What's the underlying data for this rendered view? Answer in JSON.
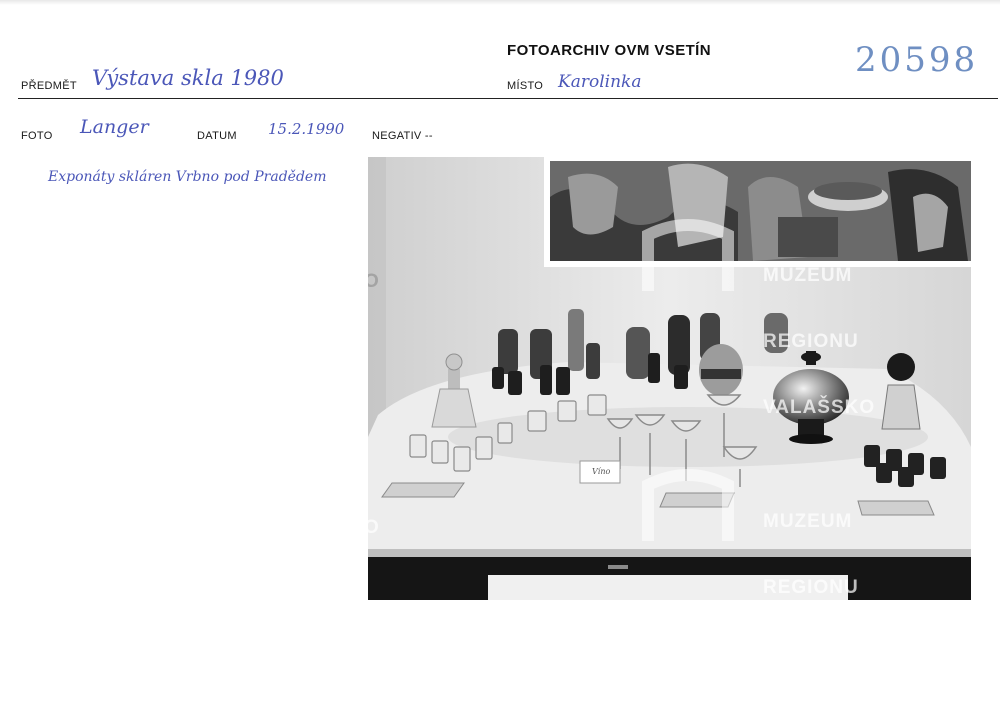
{
  "header": {
    "archive_title": "FOTOARCHIV OVM VSETÍN",
    "archive_number": "20598",
    "subject_label": "PŘEDMĚT",
    "subject_value": "Výstava skla 1980",
    "place_label": "MÍSTO",
    "place_value": "Karolinka"
  },
  "details": {
    "photo_label": "FOTO",
    "photo_value": "Langer",
    "date_label": "DATUM",
    "date_value": "15.2.1990",
    "negative_label": "NEGATIV --"
  },
  "description": "Exponáty skláren Vrbno pod Pradědem",
  "photo": {
    "watermark_lines": [
      "MUZEUM",
      "REGIONU",
      "VALAŠSKO"
    ],
    "edge_mark": "O",
    "table_card_text": "Víno"
  }
}
